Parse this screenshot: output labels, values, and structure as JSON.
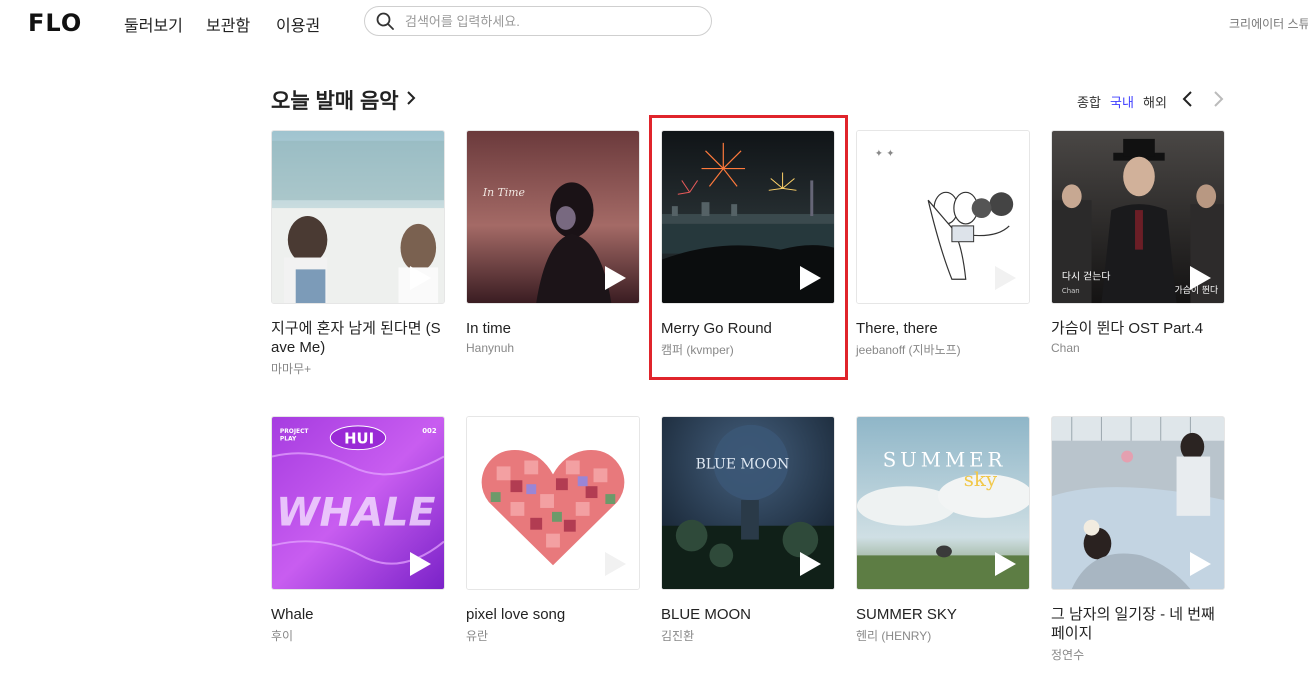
{
  "header": {
    "logo": "FLO",
    "nav": [
      "둘러보기",
      "보관함",
      "이용권"
    ],
    "search_placeholder": "검색어를 입력하세요.",
    "creator_link": "크리에이터 스튜"
  },
  "section": {
    "title": "오늘 발매 음악",
    "filters": [
      "종합",
      "국내",
      "해외"
    ],
    "active_filter": "국내"
  },
  "albums": [
    {
      "title": "지구에 혼자 남게 된다면 (Save Me)",
      "artist": "마마무+"
    },
    {
      "title": "In time",
      "artist": "Hanynuh"
    },
    {
      "title": "Merry Go Round",
      "artist": "캠퍼 (kvmper)"
    },
    {
      "title": "There, there",
      "artist": "jeebanoff (지바노프)"
    },
    {
      "title": "가슴이 뛴다 OST Part.4",
      "artist": "Chan"
    },
    {
      "title": "Whale",
      "artist": "후이"
    },
    {
      "title": "pixel love song",
      "artist": "유란"
    },
    {
      "title": "BLUE MOON",
      "artist": "김진환"
    },
    {
      "title": "SUMMER SKY",
      "artist": "헨리 (HENRY)"
    },
    {
      "title": "그 남자의 일기장 - 네 번째 페이지",
      "artist": "정연수"
    }
  ],
  "cover_text": {
    "in_time": "In Time",
    "hui": "HUI",
    "whale": "WHALE",
    "project": "PROJECT",
    "play": "PLAY",
    "num": "002",
    "blue_moon": "BLUE MOON",
    "summer": "SUMMER",
    "sky": "sky",
    "drama_title": "다시 걷는다",
    "drama_right": "가슴이 뛴다",
    "chan": "Chan"
  },
  "colors": {
    "accent": "#3f3fff",
    "highlight": "#e0242b"
  }
}
